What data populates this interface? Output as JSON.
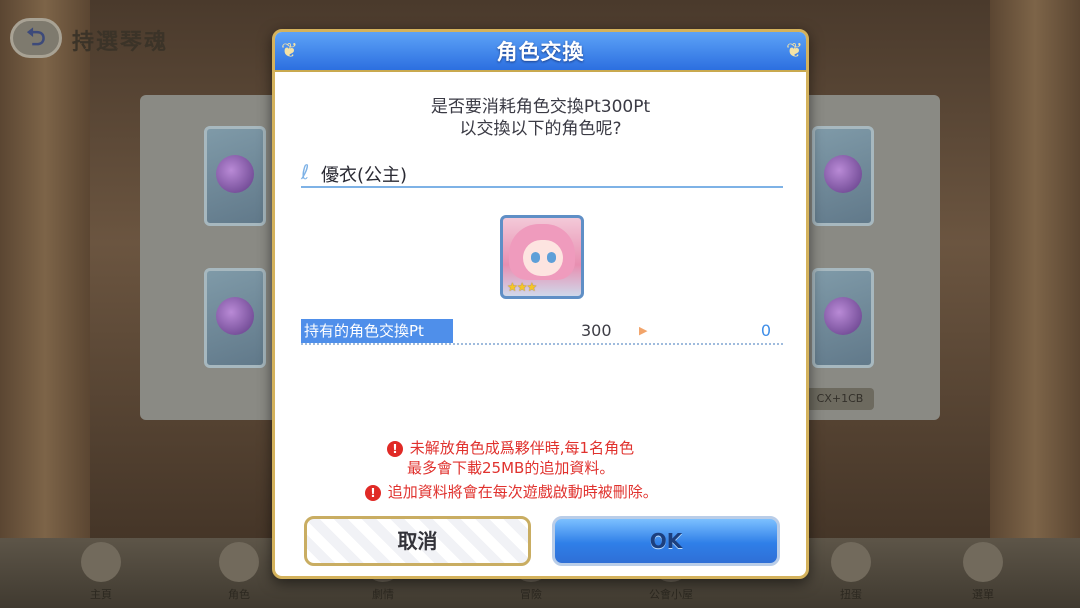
{
  "background": {
    "page_title": "持選琴魂",
    "back_icon": "back-arrow-icon",
    "badge_text": "CX+1CB",
    "nav": [
      {
        "label": "主頁",
        "icon": "home-icon"
      },
      {
        "label": "角色",
        "icon": "character-icon"
      },
      {
        "label": "劇情",
        "icon": "story-icon"
      },
      {
        "label": "冒險",
        "icon": "adventure-icon"
      },
      {
        "label": "公會小屋",
        "icon": "guild-house-icon"
      },
      {
        "label": "扭蛋",
        "icon": "gacha-icon"
      },
      {
        "label": "選單",
        "icon": "menu-icon"
      }
    ]
  },
  "dialog": {
    "title": "角色交換",
    "question_line1": "是否要消耗角色交換Pt300Pt",
    "question_line2": "以交換以下的角色呢?",
    "character_name": "優衣(公主)",
    "portrait_icon": "character-portrait",
    "stars": "★★★",
    "pt_label": "持有的角色交換Pt",
    "pt_before": "300",
    "pt_after": "0",
    "warnings": [
      {
        "line1": "未解放角色成爲夥伴時,每1名角色",
        "line2": "最多會下載25MB的追加資料。"
      },
      {
        "line1": "追加資料將會在每次遊戲啟動時被刪除。"
      }
    ],
    "cancel_label": "取消",
    "ok_label": "OK"
  },
  "colors": {
    "header_blue": "#2c6fe0",
    "gold_border": "#d4b25c",
    "warning_red": "#e0322e",
    "pt_label_blue": "#4f8fea"
  }
}
